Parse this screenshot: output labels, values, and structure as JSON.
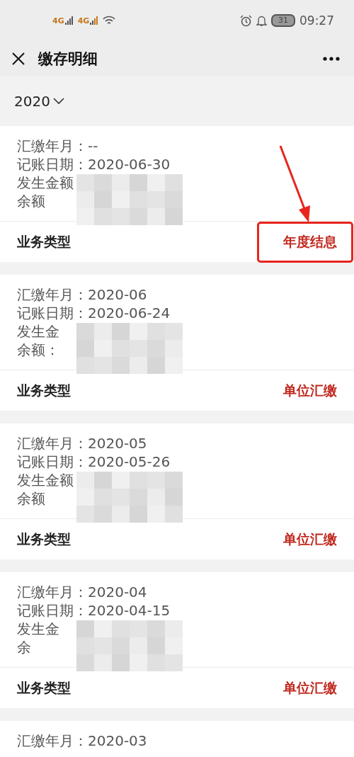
{
  "status_bar": {
    "networks": [
      "4G",
      "4G"
    ],
    "battery": "31",
    "time": "09:27"
  },
  "header": {
    "title": "缴存明细"
  },
  "year_filter": {
    "value": "2020"
  },
  "records": [
    {
      "lines": [
        "汇缴年月：--",
        "记账日期：2020-06-30",
        "发生金额",
        "余额"
      ],
      "type_label": "业务类型",
      "type_value": "年度结息",
      "redacted": true,
      "highlighted": true
    },
    {
      "lines": [
        "汇缴年月：2020-06",
        "记账日期：2020-06-24",
        "发生金",
        "余额："
      ],
      "type_label": "业务类型",
      "type_value": "单位汇缴",
      "redacted": true,
      "highlighted": false
    },
    {
      "lines": [
        "汇缴年月：2020-05",
        "记账日期：2020-05-26",
        "发生金额",
        "余额"
      ],
      "type_label": "业务类型",
      "type_value": "单位汇缴",
      "redacted": true,
      "highlighted": false
    },
    {
      "lines": [
        "汇缴年月：2020-04",
        "记账日期：2020-04-15",
        "发生金",
        "余"
      ],
      "type_label": "业务类型",
      "type_value": "单位汇缴",
      "redacted": true,
      "highlighted": false
    },
    {
      "lines": [
        "汇缴年月：2020-03"
      ]
    }
  ]
}
